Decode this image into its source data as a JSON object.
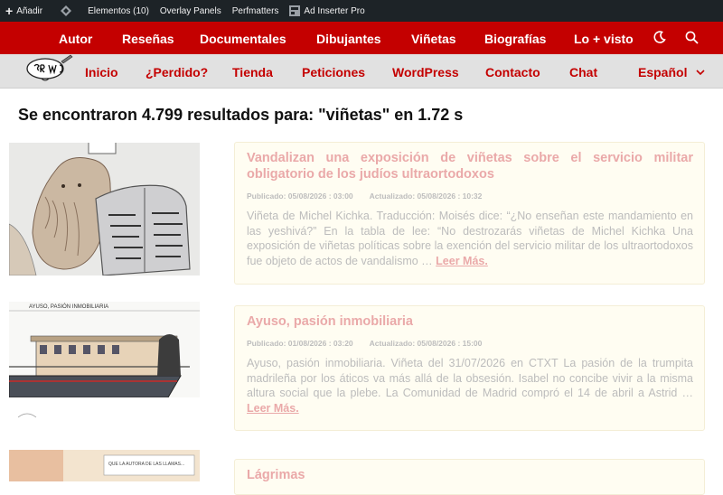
{
  "admin_bar": {
    "add_label": "Añadir",
    "elementor_label": "Elementos (10)",
    "overlay_label": "Overlay Panels",
    "perfmatters_label": "Perfmatters",
    "adinserter_label": "Ad Inserter Pro"
  },
  "main_nav": {
    "items": [
      "Autor",
      "Reseñas",
      "Documentales",
      "Dibujantes",
      "Viñetas",
      "Biografías",
      "Lo + visto"
    ]
  },
  "sub_nav": {
    "items": [
      "Inicio",
      "¿Perdido?",
      "Tienda",
      "Peticiones",
      "WordPress",
      "Contacto",
      "Chat"
    ],
    "language": "Español"
  },
  "results_heading": "Se encontraron 4.799 resultados para: \"viñetas\" en 1.72 s",
  "results": [
    {
      "title": "Vandalizan una exposición de viñetas sobre el servicio militar obligatorio de los judíos ultraortodoxos",
      "published": "Publicado: 05/08/2026 : 03:00",
      "updated": "Actualizado: 05/08/2026 : 10:32",
      "excerpt": "Viñeta de Michel Kichka. Traducción: Moisés dice: “¿No enseñan este mandamiento en las yeshivá?” En la tabla de lee: “No destrozarás viñetas de Michel Kichka Una exposición de viñetas políticas sobre la exención del servicio militar de los ultraortodoxos fue objeto de actos de vandalismo …",
      "read_more": "Leer Más."
    },
    {
      "title": "Ayuso, pasión inmobiliaria",
      "published": "Publicado: 01/08/2026 : 03:20",
      "updated": "Actualizado: 05/08/2026 : 15:00",
      "excerpt": "Ayuso, pasión inmobiliaria. Viñeta del 31/07/2026 en CTXT La pasión de la trumpita madrileña por los áticos va más allá de la obsesión. Isabel no concibe vivir a la misma altura social que la plebe. La Comunidad de Madrid compró el 14 de abril a Astrid …",
      "read_more": "Leer Más.",
      "thumb_caption": "AYUSO, PASIÓN INMOBILIARIA"
    },
    {
      "title": "Lágrimas",
      "thumb_caption": "QUE LA AUTORA DE LAS LLAMAS..."
    }
  ],
  "colors": {
    "brand_red": "#c40000",
    "admin_bar": "#1d2327",
    "subnav_bg": "#e1e1e1"
  }
}
